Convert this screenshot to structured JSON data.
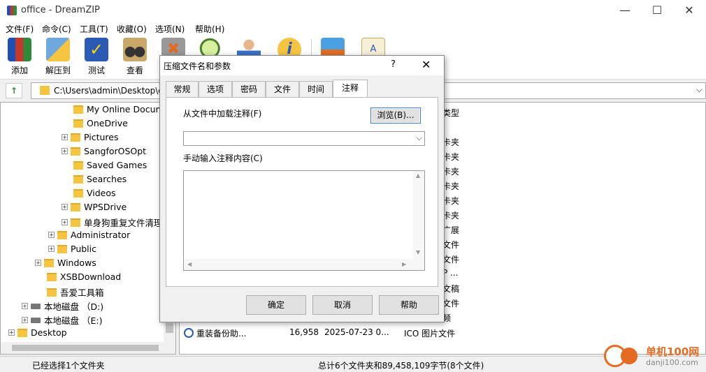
{
  "window": {
    "title": "office - DreamZIP",
    "controls": [
      "—",
      "☐",
      "✕"
    ]
  },
  "menu": [
    "文件(F)",
    "命令(C)",
    "工具(T)",
    "收藏(O)",
    "选项(N)",
    "帮助(H)"
  ],
  "toolbar": [
    {
      "label": "添加",
      "icon": "add-archive-icon"
    },
    {
      "label": "解压到",
      "icon": "extract-icon"
    },
    {
      "label": "测试",
      "icon": "test-icon"
    },
    {
      "label": "查看",
      "icon": "view-icon"
    }
  ],
  "address": {
    "path": "C:\\Users\\admin\\Desktop\\o"
  },
  "tree": [
    {
      "label": "My Online Docume",
      "expander": false
    },
    {
      "label": "OneDrive",
      "expander": false
    },
    {
      "label": "Pictures",
      "expander": true
    },
    {
      "label": "SangforOSOpt",
      "expander": true
    },
    {
      "label": "Saved Games",
      "expander": false
    },
    {
      "label": "Searches",
      "expander": false
    },
    {
      "label": "Videos",
      "expander": false
    },
    {
      "label": "WPSDrive",
      "expander": true
    },
    {
      "label": "单身狗重复文件清理",
      "expander": true
    },
    {
      "label": "Administrator",
      "expander": true
    },
    {
      "label": "Public",
      "expander": true
    },
    {
      "label": "Windows",
      "expander": true
    },
    {
      "label": "XSBDownload",
      "expander": false
    },
    {
      "label": "吾爱工具箱",
      "expander": false
    },
    {
      "label": "本地磁盘 （D:)",
      "expander": true
    },
    {
      "label": "本地磁盘 （E:)",
      "expander": true
    },
    {
      "label": "Desktop",
      "expander": true
    }
  ],
  "filelist": {
    "type_fragments": [
      "类型",
      "卡夹",
      "卡夹",
      "卡夹",
      "卡夹",
      "卡夹",
      "卡夹",
      "广展",
      "文件",
      "文件",
      "P ...",
      "文稿",
      "文件",
      "频"
    ],
    "file_row": {
      "name": "重装备份助...",
      "size": "16,958",
      "date": "2025-07-23 0...",
      "type": "ICO 图片文件"
    }
  },
  "status": {
    "left": "已经选择1个文件夹",
    "right": "总计6个文件夹和89,458,109字节(8个文件)"
  },
  "watermark": {
    "title": "单机100网",
    "url": "danji100.com"
  },
  "dialog": {
    "title": "压缩文件名和参数",
    "help": "?",
    "close": "✕",
    "tabs": [
      "常规",
      "选项",
      "密码",
      "文件",
      "时间",
      "注释"
    ],
    "load_label": "从文件中加载注释(F)",
    "browse_label": "浏览(B)...",
    "manual_label": "手动输入注释内容(C)",
    "ok_label": "确定",
    "cancel_label": "取消",
    "help_label": "帮助"
  }
}
